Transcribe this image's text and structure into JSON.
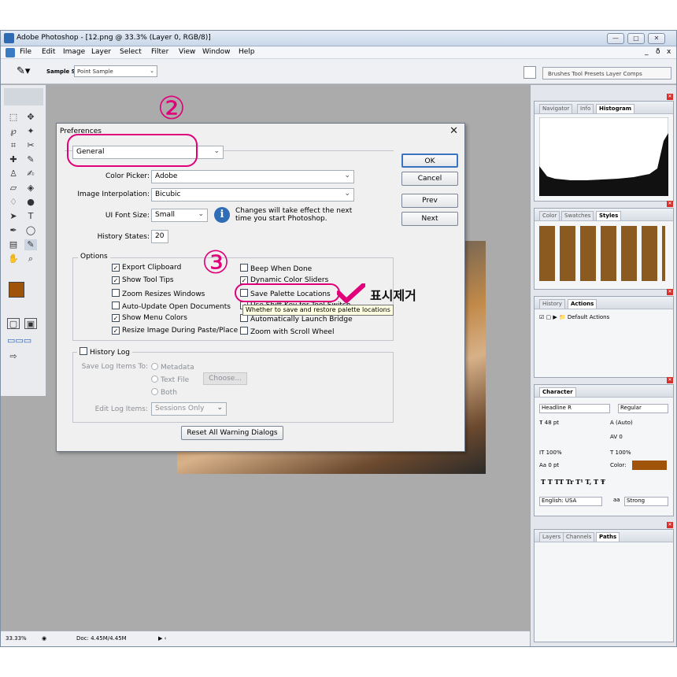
{
  "window": {
    "title": "Adobe Photoshop - [12.png @ 33.3% (Layer 0, RGB/8)]",
    "buttons": {
      "minimize": "—",
      "maximize": "□",
      "close": "✕"
    }
  },
  "menu": [
    "File",
    "Edit",
    "Image",
    "Layer",
    "Select",
    "Filter",
    "View",
    "Window",
    "Help"
  ],
  "menu_right": [
    "_",
    "ð",
    "x"
  ],
  "options_bar": {
    "sample_size_label": "Sample Size:",
    "sample_size_value": "Point Sample",
    "palette_tabs": "Brushes  Tool Presets  Layer Comps"
  },
  "status_bar": {
    "zoom": "33.33%",
    "doc": "Doc: 4.45M/4.45M"
  },
  "panels": {
    "nav_tabs": [
      "Navigator",
      "Info",
      "Histogram"
    ],
    "color_tabs": [
      "Color",
      "Swatches",
      "Styles"
    ],
    "history_tabs": [
      "History",
      "Actions"
    ],
    "actions_item": "Default Actions",
    "character": {
      "tab": "Character",
      "font": "Headline R",
      "style": "Regular",
      "size": "48 pt",
      "leading": "(Auto)",
      "tracking": "0",
      "vscale": "100%",
      "hscale": "100%",
      "baseline": "0 pt",
      "color_label": "Color:",
      "language": "English: USA",
      "aa_label": "aa",
      "aa": "Strong",
      "style_buttons": "T  T  TT  Tr  T¹  T,  T  Ŧ"
    },
    "layers_tabs": [
      "Layers",
      "Channels",
      "Paths"
    ]
  },
  "dialog": {
    "title": "Preferences",
    "section": "General",
    "color_picker_label": "Color Picker:",
    "color_picker": "Adobe",
    "interp_label": "Image Interpolation:",
    "interp": "Bicubic",
    "ui_font_label": "UI Font Size:",
    "ui_font": "Small",
    "ui_font_note": "Changes will take effect the next time you start Photoshop.",
    "history_states_label": "History States:",
    "history_states": "20",
    "options_label": "Options",
    "options_left": [
      {
        "label": "Export Clipboard",
        "checked": true
      },
      {
        "label": "Show Tool Tips",
        "checked": true
      },
      {
        "label": "Zoom Resizes Windows",
        "checked": false
      },
      {
        "label": "Auto-Update Open Documents",
        "checked": false
      },
      {
        "label": "Show Menu Colors",
        "checked": true
      },
      {
        "label": "Resize Image During Paste/Place",
        "checked": true
      }
    ],
    "options_right": [
      {
        "label": "Beep When Done",
        "checked": false
      },
      {
        "label": "Dynamic Color Sliders",
        "checked": true
      },
      {
        "label": "Save Palette Locations",
        "checked": false
      },
      {
        "label": "Use Shift Key for Tool Switch",
        "checked": true
      },
      {
        "label": "Automatically Launch Bridge",
        "checked": false
      },
      {
        "label": "Zoom with Scroll Wheel",
        "checked": false
      }
    ],
    "tooltip": "Whether to save and restore palette locations",
    "history_log_label": "History Log",
    "save_log_label": "Save Log Items To:",
    "radio_metadata": "Metadata",
    "radio_text": "Text File",
    "choose_btn": "Choose...",
    "radio_both": "Both",
    "edit_log_label": "Edit Log Items:",
    "edit_log": "Sessions Only",
    "reset_btn": "Reset All Warning Dialogs",
    "ok": "OK",
    "cancel": "Cancel",
    "prev": "Prev",
    "next": "Next"
  },
  "annotations": {
    "step2": "②",
    "step3": "③",
    "note": "표시제거"
  },
  "colors": {
    "annotation": "#e0007a",
    "swatch_color": "#a0540a"
  }
}
